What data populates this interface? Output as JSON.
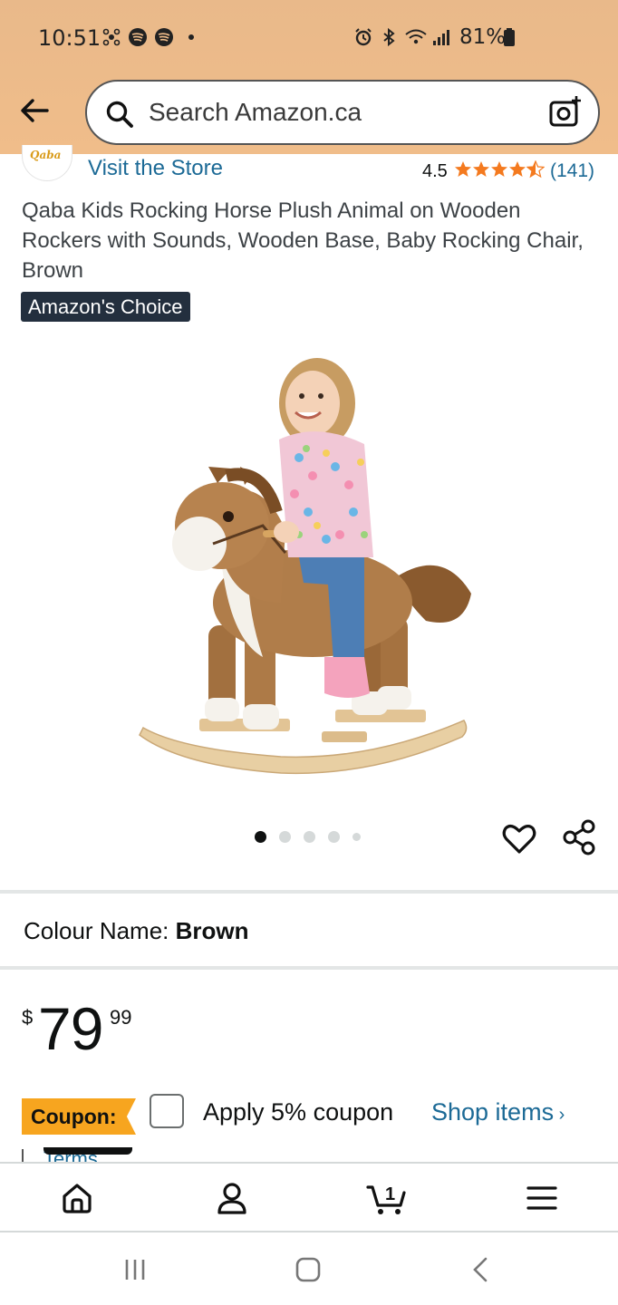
{
  "status_bar": {
    "time": "10:51",
    "battery": "81%"
  },
  "header": {
    "search_placeholder": "Search Amazon.ca",
    "background_color": "#f0bd8a"
  },
  "store": {
    "brand_logo_text": "Qaba",
    "visit_store": "Visit the Store",
    "rating": "4.5",
    "rating_count": "(141)",
    "star_color": "#f47a1f"
  },
  "product": {
    "title": "Qaba Kids Rocking Horse Plush Animal on Wooden Rockers with Sounds, Wooden Base, Baby Rocking Chair, Brown",
    "badge": "Amazon's Choice",
    "image_count": 5,
    "active_image_index": 0
  },
  "colour": {
    "label": "Colour Name:",
    "value": "Brown"
  },
  "price": {
    "currency": "$",
    "whole": "79",
    "fraction": "99"
  },
  "coupon": {
    "badge": "Coupon:",
    "apply_text": "Apply 5% coupon",
    "shop_items": "Shop items",
    "terms": "Terms",
    "badge_color": "#f7a51f"
  },
  "bottom_nav": {
    "cart_count": "1",
    "items": [
      "home-icon",
      "account-icon",
      "cart-icon",
      "menu-icon"
    ]
  },
  "system_nav": {
    "items": [
      "recents-icon",
      "home-button-icon",
      "back-nav-icon"
    ]
  },
  "link_color": "#1c6a96"
}
